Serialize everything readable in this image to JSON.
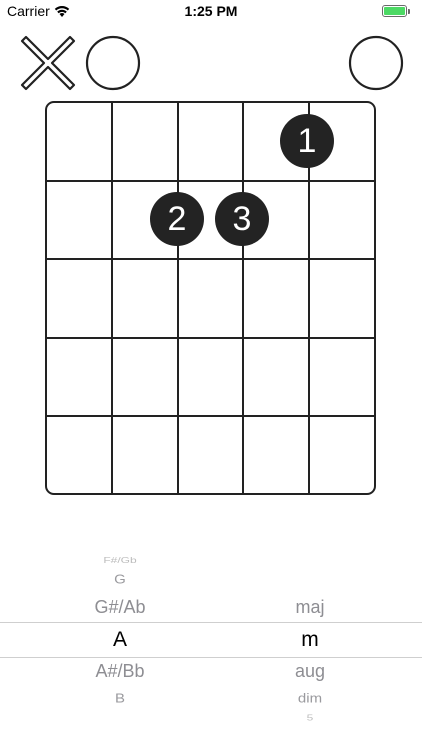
{
  "status_bar": {
    "carrier": "Carrier",
    "time": "1:25 PM"
  },
  "strings": [
    "muted",
    "open",
    "fretted",
    "fretted",
    "fretted",
    "open"
  ],
  "fretboard": {
    "frets_shown": 5,
    "strings_count": 6,
    "fingers": [
      {
        "label": "1",
        "string": 5,
        "fret": 1
      },
      {
        "label": "2",
        "string": 3,
        "fret": 2
      },
      {
        "label": "3",
        "string": 4,
        "fret": 2
      }
    ]
  },
  "picker": {
    "root": {
      "items": [
        "F#/Gb",
        "G",
        "G#/Ab",
        "A",
        "A#/Bb",
        "B"
      ],
      "selected": "A"
    },
    "quality": {
      "items": [
        "maj",
        "m",
        "aug",
        "dim",
        "5"
      ],
      "selected": "m"
    }
  },
  "colors": {
    "finger": "#232323",
    "grid": "#222222",
    "battery": "#4cd964",
    "picker_text": "#8e8e93"
  }
}
